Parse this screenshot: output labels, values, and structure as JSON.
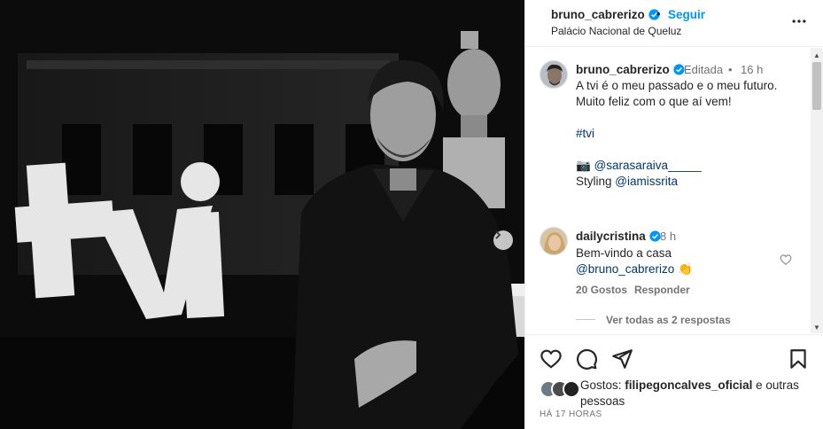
{
  "post": {
    "author": "bruno_cabrerizo",
    "follow_label": "Seguir",
    "separator": "•",
    "location": "Palácio Nacional de Queluz",
    "photo_sign_text": "tvi"
  },
  "caption": {
    "user": "bruno_cabrerizo",
    "edited": "Editada",
    "separator": "•",
    "time": "16 h",
    "line1": "A tvi é o meu passado e o meu futuro.",
    "line2": "Muito feliz com o que aí vem!",
    "hashtag": "#tvi",
    "camera_emoji": "📷",
    "photo_credit": "@sarasaraiva_____",
    "styling_label": "Styling",
    "styling_credit": "@iamissrita"
  },
  "comment": {
    "user": "dailycristina",
    "time": "8 h",
    "line1": "Bem-vindo a casa",
    "mention": "@bruno_cabrerizo",
    "emoji": "👏",
    "likes": "20 Gostos",
    "reply": "Responder",
    "view_replies": "Ver todas as 2 respostas"
  },
  "likes": {
    "prefix": "Gostos:",
    "user": "filipegoncalves_oficial",
    "suffix": "e outras pessoas"
  },
  "time_ago": "HÁ 17 HORAS",
  "icons": [
    "heart-icon",
    "comment-icon",
    "share-icon",
    "bookmark-icon",
    "more-icon",
    "verified-badge-icon",
    "chevron-right-icon"
  ],
  "colors": {
    "accent": "#0095f6",
    "verified": "#0095f6",
    "link": "#00376b",
    "muted": "#737373"
  }
}
